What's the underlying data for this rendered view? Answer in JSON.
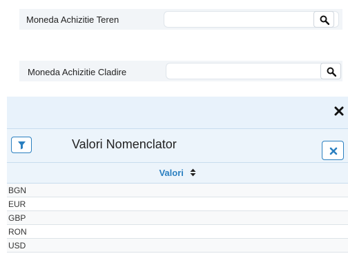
{
  "fields": [
    {
      "label": "Moneda Achizitie Teren",
      "value": ""
    },
    {
      "label": "Moneda Achizitie Cladire",
      "value": ""
    }
  ],
  "dialog": {
    "title": "Valori Nomenclator",
    "column_header": "Valori",
    "rows": [
      "BGN",
      "EUR",
      "GBP",
      "RON",
      "USD"
    ]
  },
  "colors": {
    "accent": "#2a7fc0",
    "panel_bg": "#e8f2fb"
  },
  "icons": {
    "search": "search-icon",
    "close": "close-icon",
    "filter": "filter-icon",
    "dismiss": "close-icon",
    "sort": "sort-icon"
  }
}
